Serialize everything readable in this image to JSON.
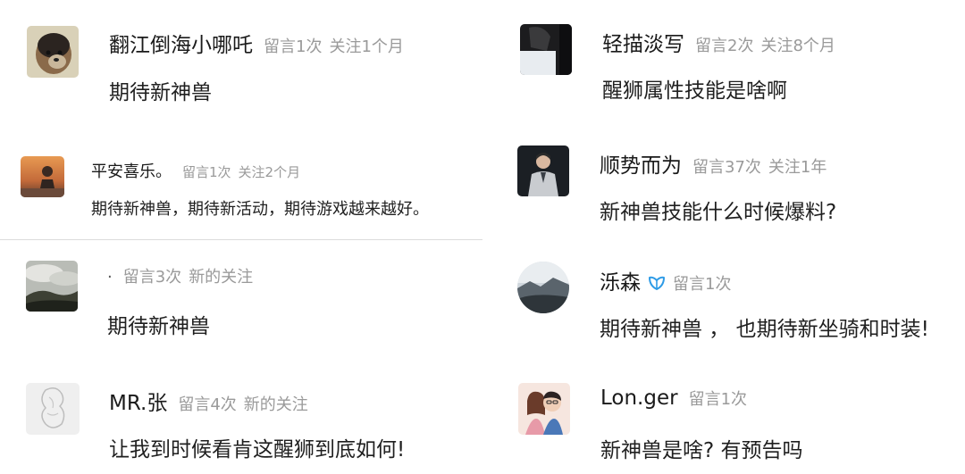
{
  "comments": [
    {
      "username": "翻江倒海小哪吒",
      "msg_count": "留言1次",
      "follow": "关注1个月",
      "text": "期待新神兽",
      "avatar": "dog-avatar"
    },
    {
      "username": "平安喜乐。",
      "msg_count": "留言1次",
      "follow": "关注2个月",
      "text": "期待新神兽，期待新活动，期待游戏越来越好。",
      "avatar": "sunset-person-avatar"
    },
    {
      "username": "·",
      "msg_count": "留言3次",
      "follow": "新的关注",
      "text": "期待新神兽",
      "avatar": "landscape-avatar"
    },
    {
      "username": "MR.张",
      "msg_count": "留言4次",
      "follow": "新的关注",
      "text": "让我到时候看肯这醒狮到底如何!",
      "avatar": "sketch-avatar"
    },
    {
      "username": "轻描淡写",
      "msg_count": "留言2次",
      "follow": "关注8个月",
      "text": "醒狮属性技能是啥啊",
      "avatar": "dark-photo-avatar"
    },
    {
      "username": "顺势而为",
      "msg_count": "留言37次",
      "follow": "关注1年",
      "text": "新神兽技能什么时候爆料?",
      "avatar": "man-avatar"
    },
    {
      "username": "泺森",
      "msg_count": "留言1次",
      "follow": "",
      "text": "期待新神兽 ， 也期待新坐骑和时装!",
      "avatar": "mountain-avatar",
      "badge": "vip-badge-icon"
    },
    {
      "username": "Lon.ger",
      "msg_count": "留言1次",
      "follow": "",
      "text": "新神兽是啥? 有预告吗",
      "avatar": "cartoon-couple-avatar"
    }
  ],
  "colors": {
    "username": "#1a1a1a",
    "stat": "#9a9a9a",
    "text": "#1f1f1f",
    "badge": "#2e9be6",
    "divider": "#dcdcdc"
  }
}
